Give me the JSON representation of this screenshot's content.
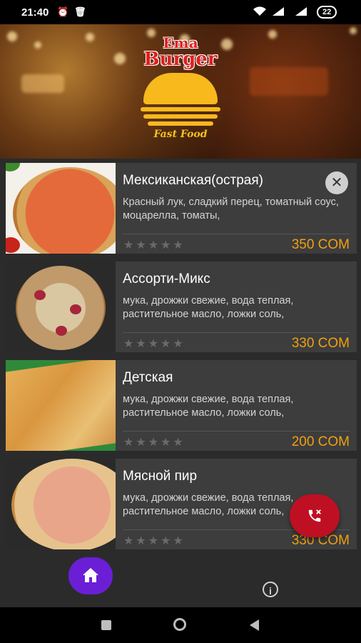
{
  "status_bar": {
    "time": "21:40",
    "battery": "22"
  },
  "header": {
    "logo_line1": "Ema",
    "logo_line2": "Burger",
    "logo_tagline": "Fast Food"
  },
  "menu_items": [
    {
      "title": "Мексиканская(острая)",
      "description": "Красный лук, сладкий перец, томатный соус, моцарелла, томаты,",
      "rating_stars": "★★★★★",
      "price": "350 COM"
    },
    {
      "title": "Ассорти-Микс",
      "description": "мука, дрожжи свежие, вода теплая, растительное масло, ложки соль,",
      "rating_stars": "★★★★★",
      "price": "330 COM"
    },
    {
      "title": "Детская",
      "description": "мука, дрожжи свежие, вода теплая, растительное масло, ложки соль,",
      "rating_stars": "★★★★★",
      "price": "200 COM"
    },
    {
      "title": "Мясной пир",
      "description": "мука, дрожжи свежие, вода теплая, растительное масло, ложки соль,",
      "rating_stars": "★★★★★",
      "price": "330 COM"
    }
  ],
  "icons": {
    "close": "close-icon",
    "home": "home-icon",
    "call": "phone-call-icon",
    "info": "info-icon"
  },
  "colors": {
    "price": "#f0a010",
    "home_fab": "#6a1fd6",
    "call_fab": "#bf0f23",
    "card_bg": "#3d3d3d"
  }
}
